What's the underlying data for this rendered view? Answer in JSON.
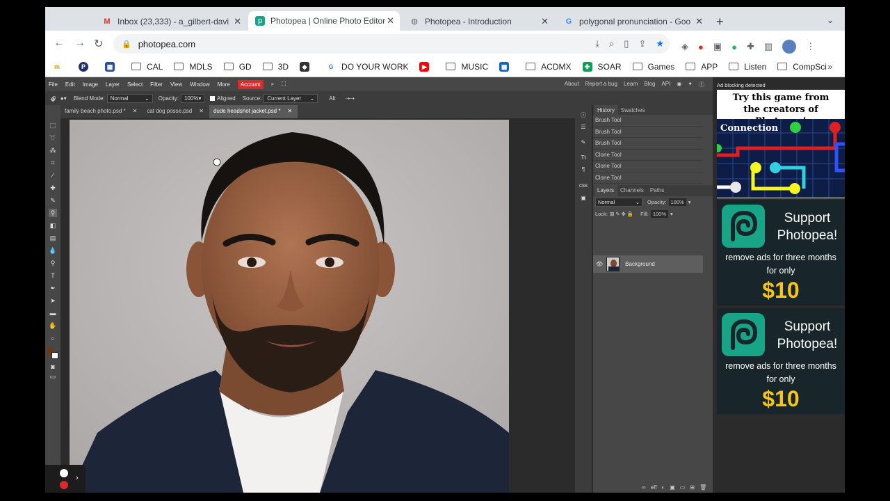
{
  "browser": {
    "tabs": [
      {
        "title": "Inbox (23,333) - a_gilbert-davi",
        "icon": "gmail-icon"
      },
      {
        "title": "Photopea | Online Photo Editor",
        "icon": "photopea-icon"
      },
      {
        "title": "Photopea - Introduction",
        "icon": "globe-icon"
      },
      {
        "title": "polygonal pronunciation - Goo",
        "icon": "google-icon"
      }
    ],
    "new_tab": "+",
    "url": "photopea.com"
  },
  "bookmarks": [
    "CAL",
    "MDLS",
    "GD",
    "3D",
    "DO YOUR WORK",
    "MUSIC",
    "ACDMX",
    "SOAR",
    "Games",
    "APP",
    "Listen",
    "CompSci"
  ],
  "bookmarks_more": "»",
  "photopea": {
    "menu": [
      "File",
      "Edit",
      "Image",
      "Layer",
      "Select",
      "Filter",
      "View",
      "Window",
      "More"
    ],
    "account": "Account",
    "menu_right": [
      "About",
      "Report a bug",
      "Learn",
      "Blog",
      "API"
    ],
    "options": {
      "blend_label": "Blend Mode:",
      "blend_value": "Normal",
      "opacity_label": "Opacity:",
      "opacity_value": "100%",
      "aligned_label": "Aligned",
      "source_label": "Source:",
      "source_value": "Current Layer",
      "alt_label": "Alt"
    },
    "doc_tabs": [
      "family beach photo.psd *",
      "cat dog posse.psd",
      "dude headshot jacket.psd *"
    ],
    "history_tabs": [
      "History",
      "Swatches"
    ],
    "history": [
      "Brush Tool",
      "Brush Tool",
      "Brush Tool",
      "Clone Tool",
      "Clone Tool",
      "Clone Tool"
    ],
    "layer_tabs": [
      "Layers",
      "Channels",
      "Paths"
    ],
    "layers_blend": "Normal",
    "layers_opacity_label": "Opacity:",
    "layers_opacity": "100%",
    "lock_label": "Lock:",
    "fill_label": "Fill:",
    "fill_value": "100%",
    "layers": [
      "Background"
    ]
  },
  "ads": {
    "notice": "Ad blocking detected",
    "game_title_line1": "Try this game from",
    "game_title_line2": "the creators of Photopea!",
    "game_name": "Connection",
    "support_line1": "Support",
    "support_line2": "Photopea!",
    "support_sub_line1": "remove ads for three months",
    "support_sub_line2": "for only",
    "support_price": "$10"
  },
  "colors": {
    "account_red": "#d92b2b",
    "photopea_green": "#18a487",
    "price_yellow": "#f5c518"
  }
}
